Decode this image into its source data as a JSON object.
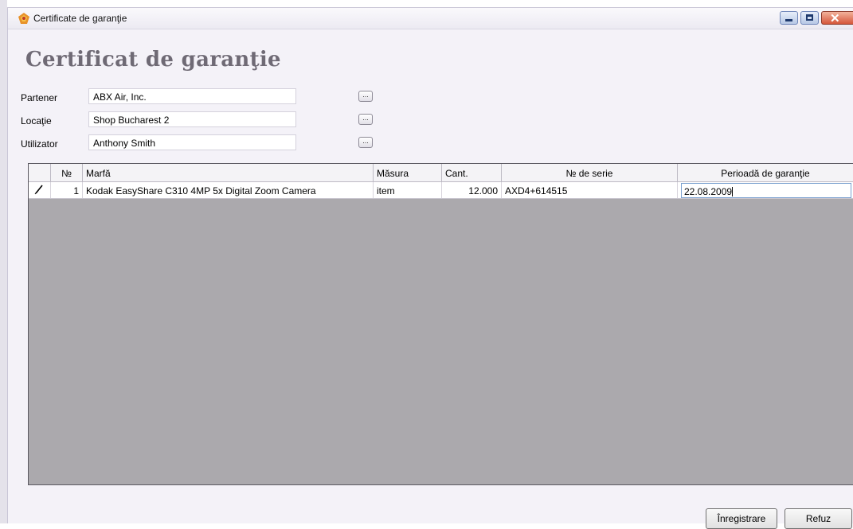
{
  "window": {
    "title": "Certificate de garanţie",
    "heading": "Certificat de garanţie",
    "controls": {
      "minimize": "minimize-icon",
      "maximize": "maximize-icon",
      "close": "close-icon"
    }
  },
  "form": {
    "partner": {
      "label": "Partener",
      "value": "ABX Air, Inc.",
      "button": "..."
    },
    "location": {
      "label": "Locaţie",
      "value": "Shop Bucharest 2",
      "button": "..."
    },
    "user": {
      "label": "Utilizator",
      "value": "Anthony Smith",
      "button": "..."
    }
  },
  "table": {
    "columns": [
      "№",
      "Marfă",
      "Măsura",
      "Cant.",
      "№ de serie",
      "Perioadă de garanţie"
    ],
    "rows": [
      {
        "indicator": "pencil-icon",
        "no": "1",
        "item": "Kodak EasyShare C310 4MP 5x Digital Zoom Camera",
        "unit": "item",
        "qty": "12.000",
        "serial": "AXD4+614515",
        "warranty": "22.08.2009"
      }
    ]
  },
  "buttons": {
    "save": "Înregistrare",
    "cancel": "Refuz"
  },
  "colors": {
    "heading": "#6f6a75",
    "grid_background": "#aba9ad",
    "window_background": "#f4f2f8",
    "close_button": "#d5573b"
  }
}
